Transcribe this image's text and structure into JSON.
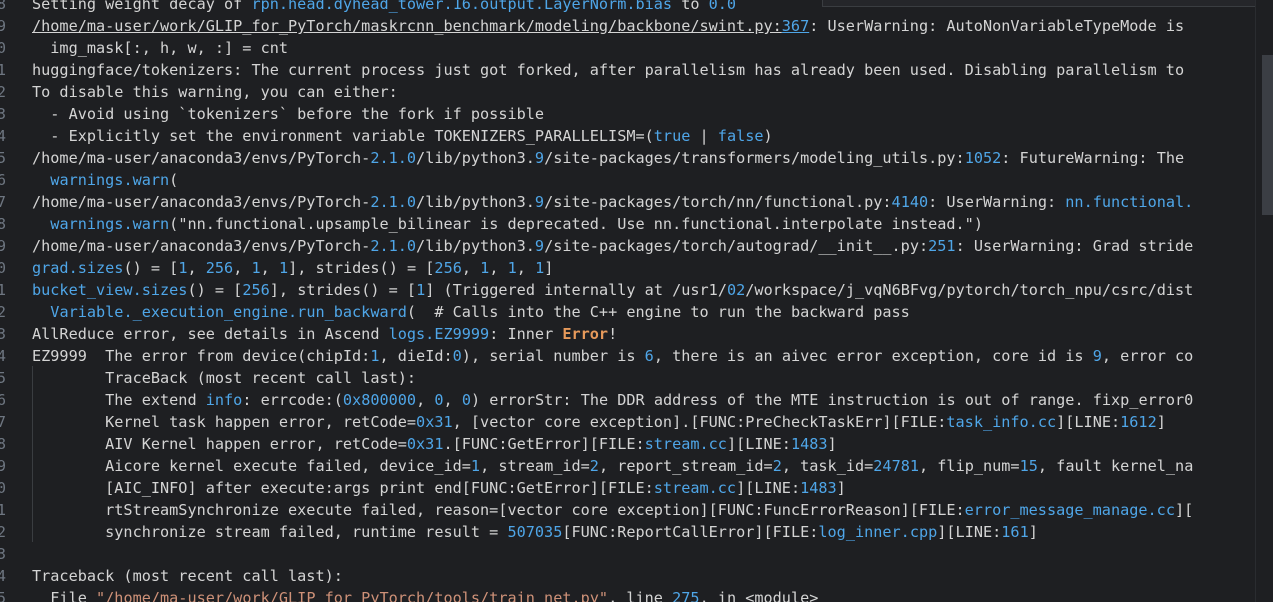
{
  "lines": [
    {
      "n": "8",
      "segs": [
        {
          "t": "Setting weight decay of "
        },
        {
          "t": "rpn.head.dyhead_tower.16.output.LayerNorm.bias",
          "c": "hl"
        },
        {
          "t": " to "
        },
        {
          "t": "0.0",
          "c": "num"
        }
      ]
    },
    {
      "n": "9",
      "segs": [
        {
          "t": "/home/ma-user/work/GLIP_for_PyTorch/maskrcnn_benchmark/modeling/backbone/swint.py:",
          "c": "u"
        },
        {
          "t": "367",
          "c": "hl u"
        },
        {
          "t": ": UserWarning: AutoNonVariableTypeMode is"
        }
      ]
    },
    {
      "n": "0",
      "segs": [
        {
          "t": "  img_mask[:, h, w, :] = cnt"
        }
      ]
    },
    {
      "n": "1",
      "segs": [
        {
          "t": "huggingface/tokenizers: The current process just got forked, after parallelism has already been used. Disabling parallelism to"
        }
      ]
    },
    {
      "n": "2",
      "segs": [
        {
          "t": "To disable this warning, you can either:"
        }
      ]
    },
    {
      "n": "3",
      "segs": [
        {
          "t": "  - Avoid using `tokenizers` before the fork if possible"
        }
      ]
    },
    {
      "n": "4",
      "segs": [
        {
          "t": "  - Explicitly set the environment variable TOKENIZERS_PARALLELISM=("
        },
        {
          "t": "true",
          "c": "hl"
        },
        {
          "t": " | "
        },
        {
          "t": "false",
          "c": "hl"
        },
        {
          "t": ")"
        }
      ]
    },
    {
      "n": "5",
      "segs": [
        {
          "t": "/home/ma-user/anaconda3/envs/PyTorch-"
        },
        {
          "t": "2.1.0",
          "c": "hl"
        },
        {
          "t": "/lib/python3."
        },
        {
          "t": "9",
          "c": "hl"
        },
        {
          "t": "/site-packages/transformers/modeling_utils.py:"
        },
        {
          "t": "1052",
          "c": "hl"
        },
        {
          "t": ": FutureWarning: The"
        }
      ]
    },
    {
      "n": "6",
      "segs": [
        {
          "t": "  "
        },
        {
          "t": "warnings.warn",
          "c": "hl"
        },
        {
          "t": "("
        }
      ]
    },
    {
      "n": "7",
      "segs": [
        {
          "t": "/home/ma-user/anaconda3/envs/PyTorch-"
        },
        {
          "t": "2.1.0",
          "c": "hl"
        },
        {
          "t": "/lib/python3."
        },
        {
          "t": "9",
          "c": "hl"
        },
        {
          "t": "/site-packages/torch/nn/functional.py:"
        },
        {
          "t": "4140",
          "c": "hl"
        },
        {
          "t": ": UserWarning: "
        },
        {
          "t": "nn.functional.",
          "c": "hl"
        }
      ]
    },
    {
      "n": "8",
      "segs": [
        {
          "t": "  "
        },
        {
          "t": "warnings.warn",
          "c": "hl"
        },
        {
          "t": "(\"nn.functional.upsample_bilinear is deprecated. Use nn.functional.interpolate instead.\")"
        }
      ]
    },
    {
      "n": "9",
      "segs": [
        {
          "t": "/home/ma-user/anaconda3/envs/PyTorch-"
        },
        {
          "t": "2.1.0",
          "c": "hl"
        },
        {
          "t": "/lib/python3."
        },
        {
          "t": "9",
          "c": "hl"
        },
        {
          "t": "/site-packages/torch/autograd/__init__.py:"
        },
        {
          "t": "251",
          "c": "hl"
        },
        {
          "t": ": UserWarning: Grad stride"
        }
      ]
    },
    {
      "n": "0",
      "segs": [
        {
          "t": "grad.sizes",
          "c": "hl"
        },
        {
          "t": "() = ["
        },
        {
          "t": "1",
          "c": "hl"
        },
        {
          "t": ", "
        },
        {
          "t": "256",
          "c": "hl"
        },
        {
          "t": ", "
        },
        {
          "t": "1",
          "c": "hl"
        },
        {
          "t": ", "
        },
        {
          "t": "1",
          "c": "hl"
        },
        {
          "t": "], strides() = ["
        },
        {
          "t": "256",
          "c": "hl"
        },
        {
          "t": ", "
        },
        {
          "t": "1",
          "c": "hl"
        },
        {
          "t": ", "
        },
        {
          "t": "1",
          "c": "hl"
        },
        {
          "t": ", "
        },
        {
          "t": "1",
          "c": "hl"
        },
        {
          "t": "]"
        }
      ]
    },
    {
      "n": "1",
      "segs": [
        {
          "t": "bucket_view.sizes",
          "c": "hl"
        },
        {
          "t": "() = ["
        },
        {
          "t": "256",
          "c": "hl"
        },
        {
          "t": "], strides() = ["
        },
        {
          "t": "1",
          "c": "hl"
        },
        {
          "t": "] (Triggered internally at /usr1/"
        },
        {
          "t": "02",
          "c": "hl"
        },
        {
          "t": "/workspace/j_vqN6BFvg/pytorch/torch_npu/csrc/dist"
        }
      ]
    },
    {
      "n": "2",
      "segs": [
        {
          "t": "  "
        },
        {
          "t": "Variable._execution_engine.run_backward",
          "c": "hl"
        },
        {
          "t": "(  # Calls into the C++ engine to run the backward pass"
        }
      ]
    },
    {
      "n": "3",
      "segs": [
        {
          "t": "AllReduce error, see details in Ascend "
        },
        {
          "t": "logs.EZ9999",
          "c": "hl"
        },
        {
          "t": ": Inner "
        },
        {
          "t": "Error",
          "c": "err"
        },
        {
          "t": "!"
        }
      ]
    },
    {
      "n": "4",
      "segs": [
        {
          "t": "EZ9999  The error from device(chipId:"
        },
        {
          "t": "1",
          "c": "hl"
        },
        {
          "t": ", dieId:"
        },
        {
          "t": "0",
          "c": "hl"
        },
        {
          "t": "), serial number is "
        },
        {
          "t": "6",
          "c": "hl"
        },
        {
          "t": ", there is an aivec error exception, core id is "
        },
        {
          "t": "9",
          "c": "hl"
        },
        {
          "t": ", error co"
        }
      ]
    },
    {
      "n": "5",
      "segs": [
        {
          "t": "        TraceBack (most recent call last):"
        }
      ]
    },
    {
      "n": "6",
      "segs": [
        {
          "t": "        The extend "
        },
        {
          "t": "info",
          "c": "hl"
        },
        {
          "t": ": errcode:("
        },
        {
          "t": "0x800000",
          "c": "hl"
        },
        {
          "t": ", "
        },
        {
          "t": "0",
          "c": "hl"
        },
        {
          "t": ", "
        },
        {
          "t": "0",
          "c": "hl"
        },
        {
          "t": ") errorStr: The DDR address of the MTE instruction is out of range. fixp_error0"
        }
      ]
    },
    {
      "n": "7",
      "segs": [
        {
          "t": "        Kernel task happen error, retCode="
        },
        {
          "t": "0x31",
          "c": "hl"
        },
        {
          "t": ", [vector core exception].[FUNC:PreCheckTaskErr][FILE:"
        },
        {
          "t": "task_info.cc",
          "c": "hl"
        },
        {
          "t": "][LINE:"
        },
        {
          "t": "1612",
          "c": "hl"
        },
        {
          "t": "]"
        }
      ]
    },
    {
      "n": "8",
      "segs": [
        {
          "t": "        AIV Kernel happen error, retCode="
        },
        {
          "t": "0x31",
          "c": "hl"
        },
        {
          "t": ".[FUNC:GetError][FILE:"
        },
        {
          "t": "stream.cc",
          "c": "hl"
        },
        {
          "t": "][LINE:"
        },
        {
          "t": "1483",
          "c": "hl"
        },
        {
          "t": "]"
        }
      ]
    },
    {
      "n": "9",
      "segs": [
        {
          "t": "        Aicore kernel execute failed, device_id="
        },
        {
          "t": "1",
          "c": "hl"
        },
        {
          "t": ", stream_id="
        },
        {
          "t": "2",
          "c": "hl"
        },
        {
          "t": ", report_stream_id="
        },
        {
          "t": "2",
          "c": "hl"
        },
        {
          "t": ", task_id="
        },
        {
          "t": "24781",
          "c": "hl"
        },
        {
          "t": ", flip_num="
        },
        {
          "t": "15",
          "c": "hl"
        },
        {
          "t": ", fault kernel_na"
        }
      ]
    },
    {
      "n": "0",
      "segs": [
        {
          "t": "        [AIC_INFO] after execute:args print end[FUNC:GetError][FILE:"
        },
        {
          "t": "stream.cc",
          "c": "hl"
        },
        {
          "t": "][LINE:"
        },
        {
          "t": "1483",
          "c": "hl"
        },
        {
          "t": "]"
        }
      ]
    },
    {
      "n": "1",
      "segs": [
        {
          "t": "        rtStreamSynchronize execute failed, reason=[vector core exception][FUNC:FuncErrorReason][FILE:"
        },
        {
          "t": "error_message_manage.cc",
          "c": "hl"
        },
        {
          "t": "]["
        }
      ]
    },
    {
      "n": "2",
      "segs": [
        {
          "t": "        synchronize stream failed, runtime result = "
        },
        {
          "t": "507035",
          "c": "hl"
        },
        {
          "t": "[FUNC:ReportCallError][FILE:"
        },
        {
          "t": "log_inner.cpp",
          "c": "hl"
        },
        {
          "t": "][LINE:"
        },
        {
          "t": "161",
          "c": "hl"
        },
        {
          "t": "]"
        }
      ]
    },
    {
      "n": "3",
      "segs": [
        {
          "t": ""
        }
      ]
    },
    {
      "n": "4",
      "segs": [
        {
          "t": "Traceback (most recent call last):"
        }
      ]
    },
    {
      "n": "5",
      "segs": [
        {
          "t": "  File "
        },
        {
          "t": "\"/home/ma-user/work/GLIP_for_PyTorch/tools/train_net.py\"",
          "c": "str"
        },
        {
          "t": ", line "
        },
        {
          "t": "275",
          "c": "hl"
        },
        {
          "t": ", in <module>"
        }
      ]
    }
  ]
}
